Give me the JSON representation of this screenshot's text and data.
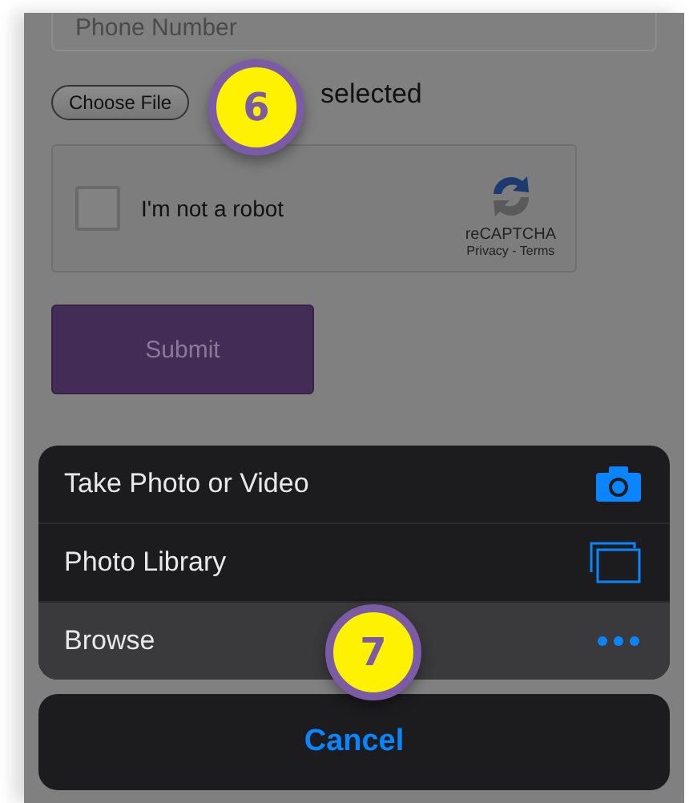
{
  "form": {
    "phone_field": {
      "placeholder": "Phone Number"
    },
    "file_button": "Choose File",
    "file_status": "selected",
    "captcha": {
      "label": "I'm not a robot",
      "checked": false,
      "brand": "reCAPTCHA",
      "links": "Privacy - Terms"
    },
    "submit": "Submit"
  },
  "action_sheet": {
    "items": [
      {
        "label": "Take Photo or Video",
        "kind": "camera",
        "selected": false
      },
      {
        "label": "Photo Library",
        "kind": "library",
        "selected": false
      },
      {
        "label": "Browse",
        "kind": "more",
        "selected": true
      }
    ],
    "cancel": "Cancel"
  },
  "step_badges": [
    {
      "number": "6"
    },
    {
      "number": "7"
    }
  ]
}
